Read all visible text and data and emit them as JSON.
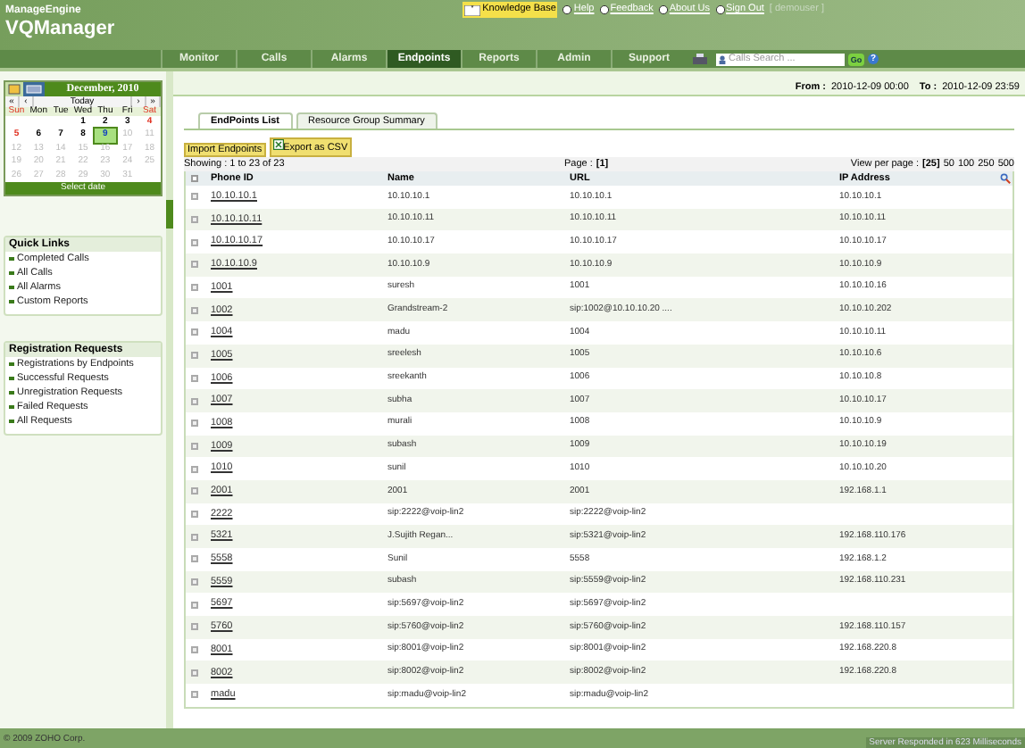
{
  "logo": {
    "brand": "ManageEngine",
    "product": "VQManager"
  },
  "top_links": [
    {
      "label": "Knowledge Base",
      "kind": "highlight"
    },
    {
      "label": "Help",
      "kind": "link"
    },
    {
      "label": "Feedback",
      "kind": "link"
    },
    {
      "label": "About Us",
      "kind": "link"
    },
    {
      "label": "Sign Out",
      "kind": "link"
    }
  ],
  "user": "[ demouser ]",
  "nav": [
    {
      "label": "Monitor",
      "selected": false
    },
    {
      "label": "Calls",
      "selected": false
    },
    {
      "label": "Alarms",
      "selected": false
    },
    {
      "label": "Endpoints",
      "selected": true
    },
    {
      "label": "Reports",
      "selected": false
    },
    {
      "label": "Admin",
      "selected": false
    },
    {
      "label": "Support",
      "selected": false
    }
  ],
  "search": {
    "placeholder": "Calls Search ...",
    "go": "Go",
    "help": "?"
  },
  "range": {
    "from_label": "From :",
    "from": "2010-12-09 00:00",
    "to_label": "To :",
    "to": "2010-12-09 23:59"
  },
  "calendar": {
    "title": "December, 2010",
    "nav": [
      "«",
      "‹",
      "Today",
      "›",
      "»"
    ],
    "weekdays": [
      "Sun",
      "Mon",
      "Tue",
      "Wed",
      "Thu",
      "Fri",
      "Sat"
    ],
    "weeks": [
      [
        {
          "kind": "blank"
        },
        {
          "kind": "blank"
        },
        {
          "kind": "blank"
        },
        {
          "label": "1",
          "future": false,
          "selected": false
        },
        {
          "label": "2",
          "future": false,
          "selected": false
        },
        {
          "label": "3",
          "future": false,
          "selected": false
        },
        {
          "label": "4",
          "future": false,
          "selected": false
        }
      ],
      [
        {
          "label": "5",
          "future": false,
          "selected": false
        },
        {
          "label": "6",
          "future": false,
          "selected": false
        },
        {
          "label": "7",
          "future": false,
          "selected": false
        },
        {
          "label": "8",
          "future": false,
          "selected": false
        },
        {
          "label": "9",
          "future": false,
          "selected": true
        },
        {
          "label": "10",
          "future": true,
          "selected": false
        },
        {
          "label": "11",
          "future": true,
          "selected": false
        }
      ],
      [
        {
          "label": "12",
          "future": true,
          "selected": false
        },
        {
          "label": "13",
          "future": true,
          "selected": false
        },
        {
          "label": "14",
          "future": true,
          "selected": false
        },
        {
          "label": "15",
          "future": true,
          "selected": false
        },
        {
          "label": "16",
          "future": true,
          "selected": false
        },
        {
          "label": "17",
          "future": true,
          "selected": false
        },
        {
          "label": "18",
          "future": true,
          "selected": false
        }
      ],
      [
        {
          "label": "19",
          "future": true,
          "selected": false
        },
        {
          "label": "20",
          "future": true,
          "selected": false
        },
        {
          "label": "21",
          "future": true,
          "selected": false
        },
        {
          "label": "22",
          "future": true,
          "selected": false
        },
        {
          "label": "23",
          "future": true,
          "selected": false
        },
        {
          "label": "24",
          "future": true,
          "selected": false
        },
        {
          "label": "25",
          "future": true,
          "selected": false
        }
      ],
      [
        {
          "label": "26",
          "future": true,
          "selected": false
        },
        {
          "label": "27",
          "future": true,
          "selected": false
        },
        {
          "label": "28",
          "future": true,
          "selected": false
        },
        {
          "label": "29",
          "future": true,
          "selected": false
        },
        {
          "label": "30",
          "future": true,
          "selected": false
        },
        {
          "label": "31",
          "future": true,
          "selected": false
        },
        {
          "kind": "blank"
        }
      ]
    ],
    "select": "Select date"
  },
  "panels": [
    {
      "title": "Quick Links",
      "items": [
        "Completed Calls",
        "All Calls",
        "All Alarms",
        "Custom Reports"
      ]
    },
    {
      "title": "Registration Requests",
      "items": [
        "Registrations by Endpoints",
        "Successful Requests",
        "Unregistration Requests",
        "Failed Requests",
        "All Requests"
      ]
    }
  ],
  "tabs": [
    {
      "label": "EndPoints List",
      "selected": true
    },
    {
      "label": "Resource Group Summary",
      "selected": false
    }
  ],
  "actions": [
    "Import Endpoints",
    "Export as CSV"
  ],
  "showing": "Showing : 1 to 23 of 23",
  "page": {
    "label": "Page :",
    "current": "[1]"
  },
  "per_page": {
    "label": "View per page :",
    "options": [
      {
        "label": "[25]",
        "selected": true
      },
      {
        "label": "50",
        "selected": false
      },
      {
        "label": "100",
        "selected": false
      },
      {
        "label": "250",
        "selected": false
      },
      {
        "label": "500",
        "selected": false
      }
    ]
  },
  "table": {
    "select_all": {
      "checked": false
    },
    "columns": [
      "Phone ID",
      "Name",
      "URL",
      "IP Address"
    ],
    "rows": [
      {
        "checked": false,
        "phone_id": "10.10.10.1",
        "name": "10.10.10.1",
        "url": "10.10.10.1",
        "ip": "10.10.10.1"
      },
      {
        "checked": false,
        "phone_id": "10.10.10.11",
        "name": "10.10.10.11",
        "url": "10.10.10.11",
        "ip": "10.10.10.11"
      },
      {
        "checked": false,
        "phone_id": "10.10.10.17",
        "name": "10.10.10.17",
        "url": "10.10.10.17",
        "ip": "10.10.10.17"
      },
      {
        "checked": false,
        "phone_id": "10.10.10.9",
        "name": "10.10.10.9",
        "url": "10.10.10.9",
        "ip": "10.10.10.9"
      },
      {
        "checked": false,
        "phone_id": "1001",
        "name": "suresh",
        "url": "1001",
        "ip": "10.10.10.16"
      },
      {
        "checked": false,
        "phone_id": "1002",
        "name": "Grandstream-2",
        "url": "sip:1002@10.10.10.20 ....",
        "ip": "10.10.10.202"
      },
      {
        "checked": false,
        "phone_id": "1004",
        "name": "madu",
        "url": "1004",
        "ip": "10.10.10.11"
      },
      {
        "checked": false,
        "phone_id": "1005",
        "name": "sreelesh",
        "url": "1005",
        "ip": "10.10.10.6"
      },
      {
        "checked": false,
        "phone_id": "1006",
        "name": "sreekanth",
        "url": "1006",
        "ip": "10.10.10.8"
      },
      {
        "checked": false,
        "phone_id": "1007",
        "name": "subha",
        "url": "1007",
        "ip": "10.10.10.17"
      },
      {
        "checked": false,
        "phone_id": "1008",
        "name": "murali",
        "url": "1008",
        "ip": "10.10.10.9"
      },
      {
        "checked": false,
        "phone_id": "1009",
        "name": "subash",
        "url": "1009",
        "ip": "10.10.10.19"
      },
      {
        "checked": false,
        "phone_id": "1010",
        "name": "sunil",
        "url": "1010",
        "ip": "10.10.10.20"
      },
      {
        "checked": false,
        "phone_id": "2001",
        "name": "2001",
        "url": "2001",
        "ip": "192.168.1.1"
      },
      {
        "checked": false,
        "phone_id": "2222",
        "name": "sip:2222@voip-lin2",
        "url": "sip:2222@voip-lin2"
      },
      {
        "checked": false,
        "phone_id": "5321",
        "name": "J.Sujith Regan...",
        "url": "sip:5321@voip-lin2",
        "ip": "192.168.110.176"
      },
      {
        "checked": false,
        "phone_id": "5558",
        "name": "Sunil",
        "url": "5558",
        "ip": "192.168.1.2"
      },
      {
        "checked": false,
        "phone_id": "5559",
        "name": "subash",
        "url": "sip:5559@voip-lin2",
        "ip": "192.168.110.231"
      },
      {
        "checked": false,
        "phone_id": "5697",
        "name": "sip:5697@voip-lin2",
        "url": "sip:5697@voip-lin2"
      },
      {
        "checked": false,
        "phone_id": "5760",
        "name": "sip:5760@voip-lin2",
        "url": "sip:5760@voip-lin2",
        "ip": "192.168.110.157"
      },
      {
        "checked": false,
        "phone_id": "8001",
        "name": "sip:8001@voip-lin2",
        "url": "sip:8001@voip-lin2",
        "ip": "192.168.220.8"
      },
      {
        "checked": false,
        "phone_id": "8002",
        "name": "sip:8002@voip-lin2",
        "url": "sip:8002@voip-lin2",
        "ip": "192.168.220.8"
      },
      {
        "checked": false,
        "phone_id": "madu",
        "name": "sip:madu@voip-lin2",
        "url": "sip:madu@voip-lin2"
      }
    ]
  },
  "footer": {
    "copyright": "© 2009 ZOHO Corp.",
    "status": "Server Responded in 623 Milliseconds"
  }
}
